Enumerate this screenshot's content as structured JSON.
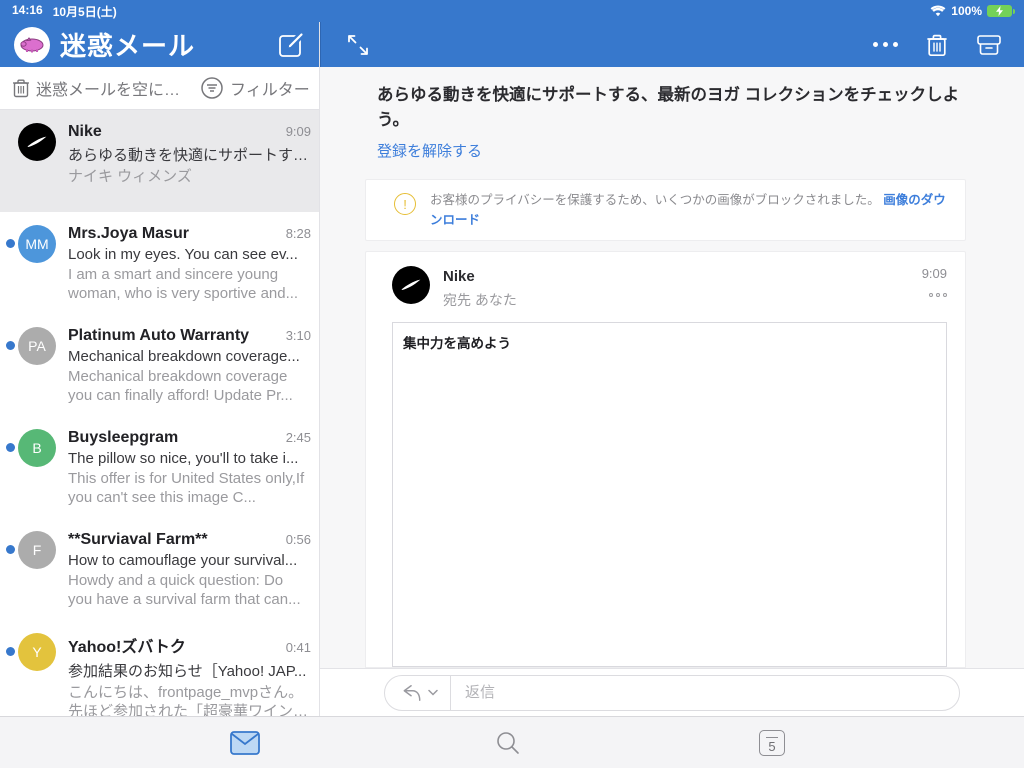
{
  "status_bar": {
    "time": "14:16",
    "date": "10月5日(土)",
    "battery": "100%"
  },
  "left_pane": {
    "title": "迷惑メール",
    "toolbar": {
      "empty_label": "迷惑メールを空に…",
      "filter_label": "フィルター"
    }
  },
  "emails": [
    {
      "initials": "",
      "name": "Nike",
      "time": "9:09",
      "subject": "あらゆる動きを快適にサポートす…",
      "preview": "ナイキ ウィメンズ",
      "unread": false,
      "selected": true,
      "avatar_color": "#000000"
    },
    {
      "initials": "MM",
      "name": "Mrs.Joya Masur",
      "time": "8:28",
      "subject": "Look in my eyes. You can see ev...",
      "preview": "I am a smart and sincere young woman, who is very sportive and...",
      "unread": true,
      "selected": false,
      "avatar_color": "#4D96DB"
    },
    {
      "initials": "PA",
      "name": "Platinum Auto Warranty",
      "time": "3:10",
      "subject": "Mechanical breakdown coverage...",
      "preview": "Mechanical breakdown coverage you can finally afford! Update Pr...",
      "unread": true,
      "selected": false,
      "avatar_color": "#ACACAC"
    },
    {
      "initials": "B",
      "name": "Buysleepgram",
      "time": "2:45",
      "subject": "The pillow so nice, you'll to take i...",
      "preview": "This offer is for United States only,If you can't see this image C...",
      "unread": true,
      "selected": false,
      "avatar_color": "#57B876"
    },
    {
      "initials": "F",
      "name": "**Surviaval Farm**",
      "time": "0:56",
      "subject": "How to camouflage your survival...",
      "preview": "Howdy and a quick question: Do you have a survival farm that can...",
      "unread": true,
      "selected": false,
      "avatar_color": "#ACACAC"
    },
    {
      "initials": "Y",
      "name": "Yahoo!ズバトク",
      "time": "0:41",
      "subject": "参加結果のお知らせ［Yahoo! JAP...",
      "preview": "こんにちは、frontpage_mvpさん。先ほど参加された「超豪華ワイン…",
      "unread": true,
      "selected": false,
      "avatar_color": "#E3C33D"
    }
  ],
  "detail": {
    "subject": "あらゆる動きを快適にサポートする、最新のヨガ コレクションをチェックしよう。",
    "unsubscribe_label": "登録を解除する",
    "privacy_notice": "お客様のプライバシーを保護するため、いくつかの画像がブロックされました。",
    "download_images_label": "画像のダウンロード",
    "sender": "Nike",
    "recipient": "宛先 あなた",
    "time": "9:09",
    "body": "集中力を高めよう",
    "reply_placeholder": "返信"
  },
  "tab_bar": {
    "badge": "5"
  },
  "colors": {
    "header_blue": "#3778CC",
    "link_blue": "#3D7EDB",
    "unread_dot": "#3778CC",
    "warning_yellow": "#E6BE35",
    "battery_green": "#74D158",
    "selected_row": "#E9E9EB"
  }
}
